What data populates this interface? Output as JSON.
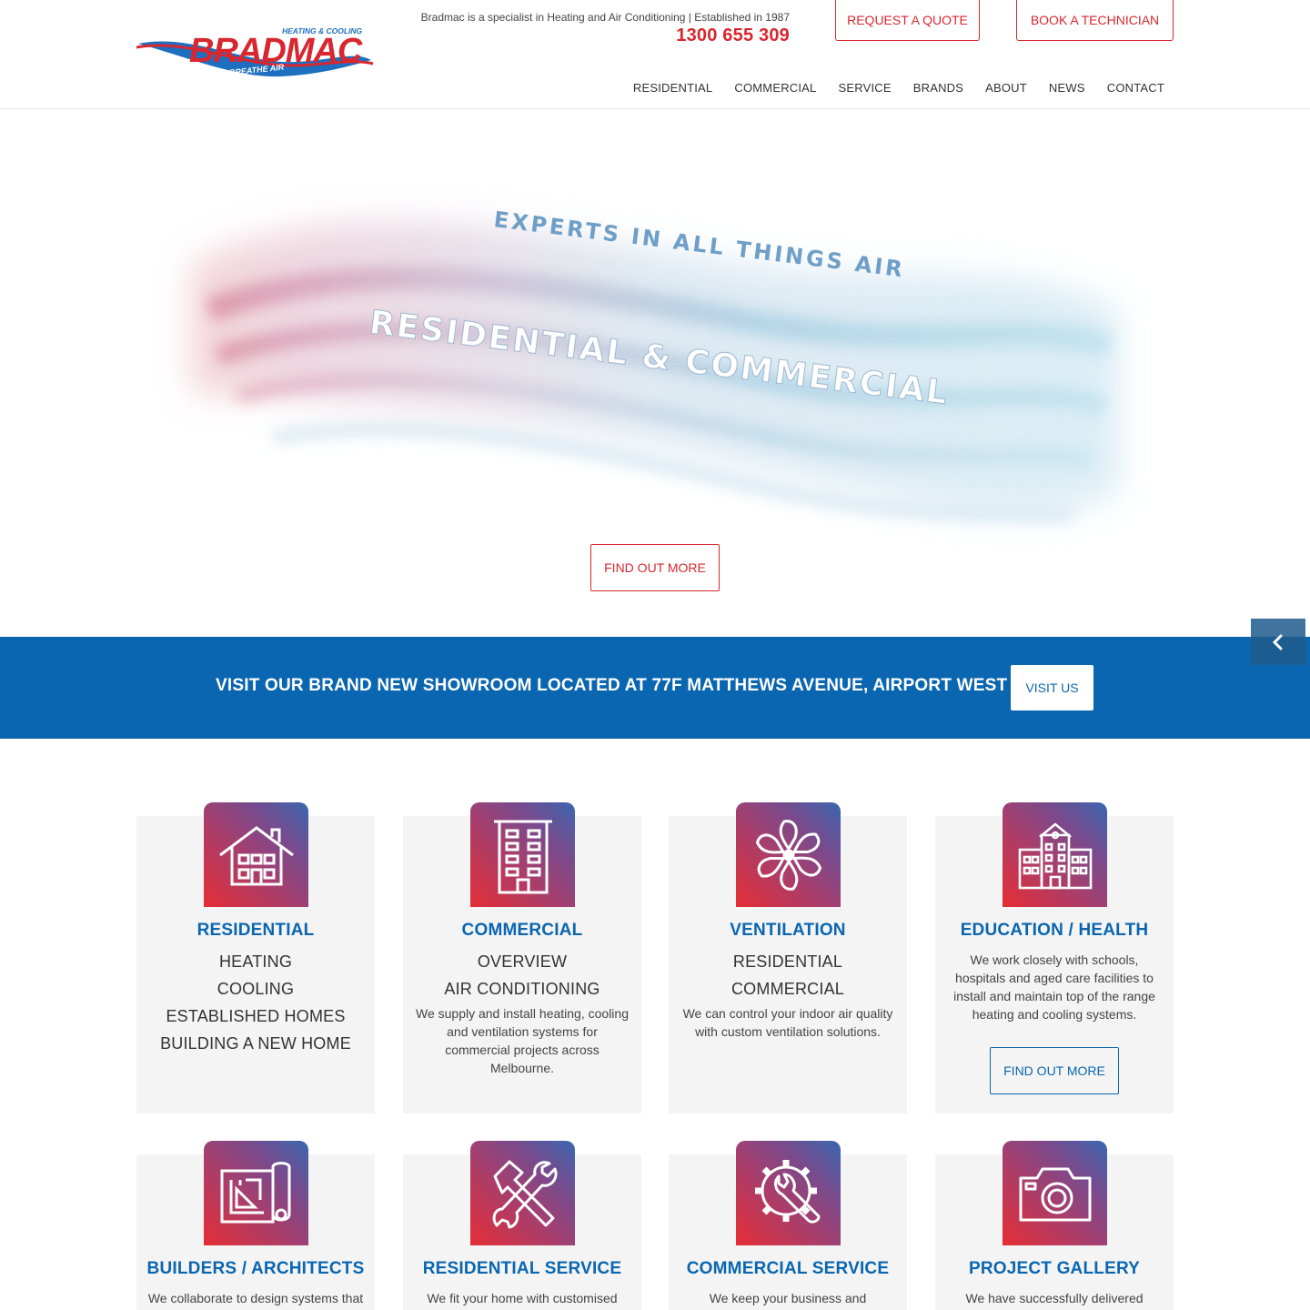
{
  "header": {
    "logo_text": "BRADMAC",
    "logo_top": "HEATING & COOLING",
    "logo_slogan": "WE LIVE & BREATHE AIR",
    "tagline": "Bradmac is a specialist in Heating and Air Conditioning | Established in 1987",
    "phone": "1300 655 309",
    "request_quote": "REQUEST A QUOTE",
    "book_technician": "BOOK A TECHNICIAN",
    "nav": [
      "RESIDENTIAL",
      "COMMERCIAL",
      "SERVICE",
      "BRANDS",
      "ABOUT",
      "NEWS",
      "CONTACT"
    ]
  },
  "hero": {
    "line1": "EXPERTS IN ALL THINGS AIR",
    "line2": "RESIDENTIAL & COMMERCIAL",
    "button": "FIND OUT MORE"
  },
  "banner": {
    "text": "VISIT OUR BRAND NEW SHOWROOM LOCATED AT 77F MATTHEWS AVENUE, AIRPORT WEST",
    "button": "VISIT US"
  },
  "cards": [
    {
      "title": "RESIDENTIAL",
      "icon": "house-icon",
      "links": [
        "HEATING",
        "COOLING",
        "ESTABLISHED HOMES",
        "BUILDING A NEW HOME"
      ],
      "desc": ""
    },
    {
      "title": "COMMERCIAL",
      "icon": "office-building-icon",
      "links": [
        "OVERVIEW",
        "AIR CONDITIONING"
      ],
      "desc": "We supply and install heating, cooling and ventilation systems for commercial projects across Melbourne."
    },
    {
      "title": "VENTILATION",
      "icon": "fan-icon",
      "links": [
        "RESIDENTIAL",
        "COMMERCIAL"
      ],
      "desc": "We can control your indoor air quality with custom ventilation solutions."
    },
    {
      "title": "EDUCATION / HEALTH",
      "icon": "school-building-icon",
      "links": [],
      "desc": "We work closely with schools, hospitals and aged care facilities to install and maintain top of the range heating and cooling systems.",
      "button": "FIND OUT MORE"
    },
    {
      "title": "BUILDERS / ARCHITECTS",
      "icon": "blueprint-icon",
      "links": [],
      "desc": "We collaborate to design systems that"
    },
    {
      "title": "RESIDENTIAL SERVICE",
      "icon": "hammer-wrench-icon",
      "links": [],
      "desc": "We fit your home with customised"
    },
    {
      "title": "COMMERCIAL SERVICE",
      "icon": "gear-wrench-icon",
      "links": [],
      "desc": "We keep your business and workplace"
    },
    {
      "title": "PROJECT GALLERY",
      "icon": "camera-icon",
      "links": [],
      "desc": "We have successfully delivered"
    }
  ],
  "colors": {
    "brand_red": "#d8272f",
    "brand_blue": "#0a66b0",
    "card_bg": "#f4f4f4"
  }
}
